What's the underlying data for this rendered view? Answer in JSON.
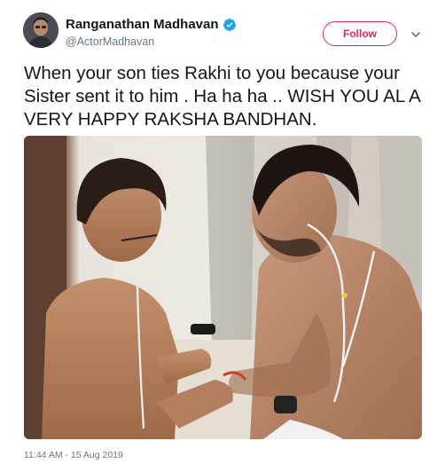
{
  "author": {
    "display_name": "Ranganathan Madhavan",
    "handle": "@ActorMadhavan",
    "verified": true
  },
  "follow_label": "Follow",
  "tweet": {
    "text": "When your son ties Rakhi to you because your Sister sent it to him . Ha ha ha .. WISH YOU AL A VERY HAPPY RAKSHA BANDHAN.",
    "timestamp": "11:44 AM - 15 Aug 2019"
  },
  "colors": {
    "follow_accent": "#e0245e",
    "verified_blue": "#1da1f2",
    "meta_grey": "#657786"
  },
  "icons": [
    "verified-badge-icon",
    "chevron-down-icon"
  ]
}
